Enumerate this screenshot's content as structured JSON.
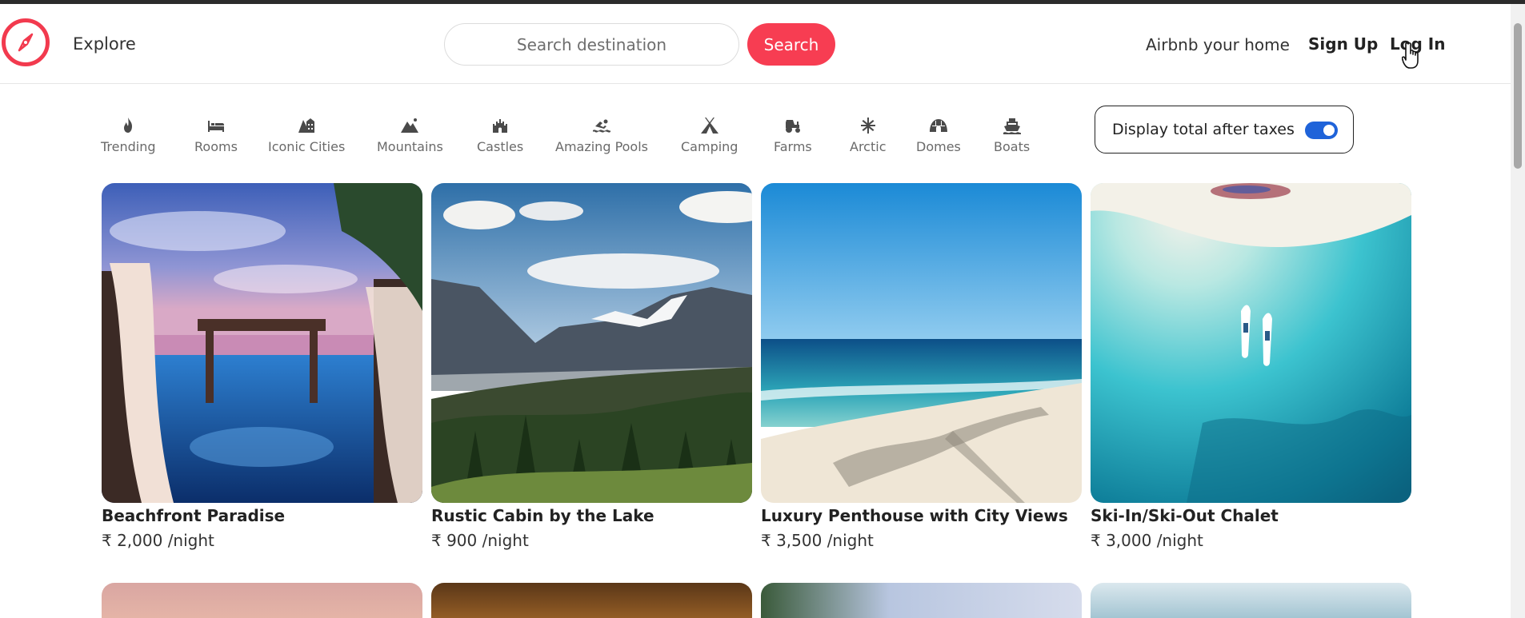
{
  "header": {
    "explore_label": "Explore",
    "search": {
      "placeholder": "Search destination",
      "value": ""
    },
    "search_button_label": "Search",
    "host_label": "Airbnb your home",
    "signup_label": "Sign Up",
    "login_label": "Log In"
  },
  "categories": [
    {
      "label": "Trending",
      "icon": "fire-icon"
    },
    {
      "label": "Rooms",
      "icon": "bed-icon"
    },
    {
      "label": "Iconic Cities",
      "icon": "city-icon"
    },
    {
      "label": "Mountains",
      "icon": "mountain-icon"
    },
    {
      "label": "Castles",
      "icon": "castle-icon"
    },
    {
      "label": "Amazing Pools",
      "icon": "swimmer-icon"
    },
    {
      "label": "Camping",
      "icon": "tent-icon"
    },
    {
      "label": "Farms",
      "icon": "tractor-icon"
    },
    {
      "label": "Arctic",
      "icon": "snowflake-icon"
    },
    {
      "label": "Domes",
      "icon": "dome-icon"
    },
    {
      "label": "Boats",
      "icon": "ship-icon"
    }
  ],
  "tax_toggle": {
    "label": "Display total after taxes",
    "on": true
  },
  "listings": [
    {
      "title": "Beachfront Paradise",
      "price": "₹ 2,000 /night"
    },
    {
      "title": "Rustic Cabin by the Lake",
      "price": "₹ 900 /night"
    },
    {
      "title": "Luxury Penthouse with City Views",
      "price": "₹ 3,500 /night"
    },
    {
      "title": "Ski-In/Ski-Out Chalet",
      "price": "₹ 3,000 /night"
    }
  ],
  "colors": {
    "brand": "#f73d52",
    "toggle": "#1f63d9"
  }
}
